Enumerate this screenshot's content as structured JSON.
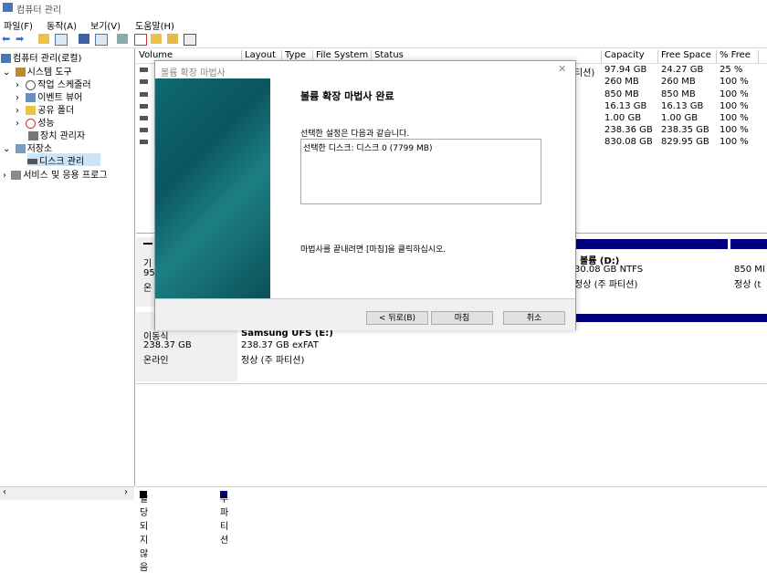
{
  "window": {
    "title": "컴퓨터 관리"
  },
  "menu": [
    "파일(F)",
    "동작(A)",
    "보기(V)",
    "도움말(H)"
  ],
  "tree": {
    "root": "컴퓨터 관리(로컬)",
    "system_tools": "시스템 도구",
    "task_scheduler": "작업 스케줄러",
    "event_viewer": "이벤트 뷰어",
    "shared_folders": "공유 폴더",
    "performance": "성능",
    "device_manager": "장치 관리자",
    "storage": "저장소",
    "disk_management": "디스크 관리",
    "services": "서비스 및 응용 프로그"
  },
  "table": {
    "headers": [
      "Volume",
      "Layout",
      "Type",
      "File System",
      "Status",
      "Capacity",
      "Free Space",
      "% Free"
    ],
    "rows": [
      {
        "status_tail": "티션)",
        "capacity": "97.94 GB",
        "free": "24.27 GB",
        "pct": "25 %"
      },
      {
        "status_tail": "",
        "capacity": "260 MB",
        "free": "260 MB",
        "pct": "100 %"
      },
      {
        "status_tail": "",
        "capacity": "850 MB",
        "free": "850 MB",
        "pct": "100 %"
      },
      {
        "status_tail": "",
        "capacity": "16.13 GB",
        "free": "16.13 GB",
        "pct": "100 %"
      },
      {
        "status_tail": "",
        "capacity": "1.00 GB",
        "free": "1.00 GB",
        "pct": "100 %"
      },
      {
        "status_tail": "",
        "capacity": "238.36 GB",
        "free": "238.35 GB",
        "pct": "100 %"
      },
      {
        "status_tail": "",
        "capacity": "830.08 GB",
        "free": "829.95 GB",
        "pct": "100 %"
      }
    ]
  },
  "disk0": {
    "label_partial_1": "기",
    "label_partial_2": "95",
    "label_partial_3": "온",
    "vol_name": "볼륨  (D:)",
    "vol_size": "30.08 GB NTFS",
    "vol_status": "정상 (주 파티션)",
    "right_size": "850 MI",
    "right_status": "정상 (t"
  },
  "disk1": {
    "kind": "이동식",
    "size": "238.37 GB",
    "state": "온라인",
    "vol_name": "Samsung UFS  (E:)",
    "vol_size": "238.37 GB exFAT",
    "vol_status": "정상 (주 파티션)"
  },
  "legend": {
    "unallocated": "할당되지 않음",
    "primary": "주 파티션"
  },
  "dialog": {
    "title": "볼륨 확장 마법사",
    "heading": "볼륨 확장 마법사 완료",
    "intro": "선택한 설정은 다음과 같습니다.",
    "selected": "선택한 디스크: 디스크 0 (7799 MB)",
    "finish_hint": "마법사를 끝내려면 [마침]을 클릭하십시오.",
    "back": "< 뒤로(B)",
    "finish": "마침",
    "cancel": "취소"
  },
  "colors": {
    "primary_blue": "#000080",
    "selection": "#cce4f7",
    "sidebar_teal": "#0f6a6f"
  }
}
